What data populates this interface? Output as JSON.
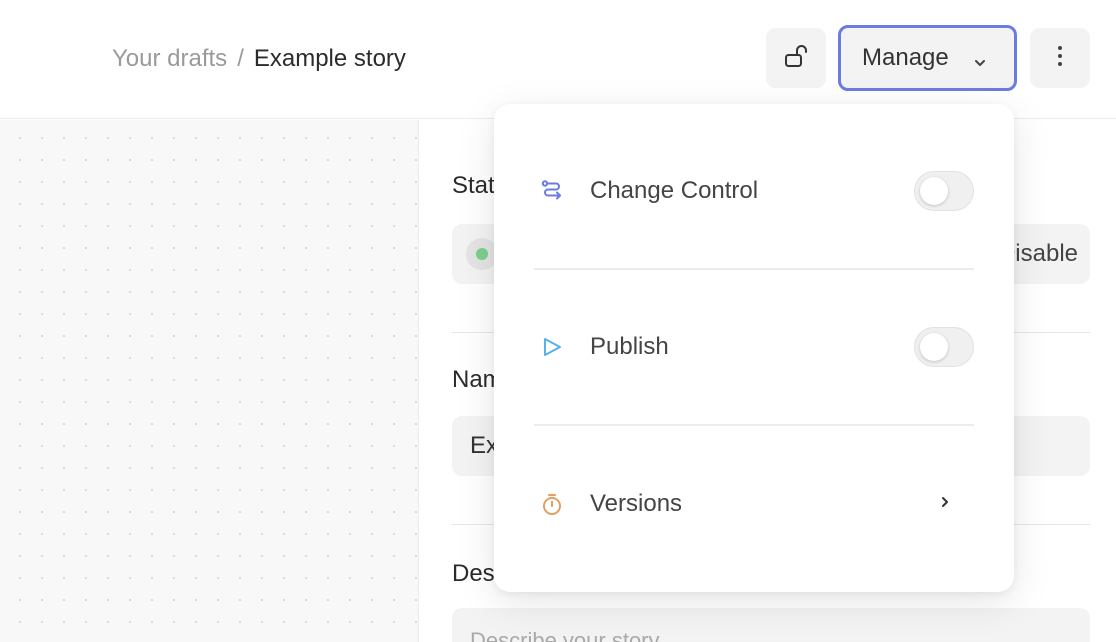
{
  "breadcrumb": {
    "parent": "Your drafts",
    "separator": "/",
    "current": "Example story"
  },
  "toolbar": {
    "lock_icon": "unlock-icon",
    "manage_label": "Manage",
    "manage_chevron_icon": "chevron-down-icon",
    "more_icon": "vertical-dots-icon",
    "accent_color": "#6b7ce0"
  },
  "panel": {
    "status_label": "Status",
    "status_dot_color": "#7cd08a",
    "status_action": "Disable",
    "name_label": "Name",
    "name_value": "Example story",
    "description_label": "Description",
    "description_placeholder": "Describe your story"
  },
  "manage_menu": {
    "items": [
      {
        "label": "Change Control",
        "icon": "branch-icon",
        "icon_color": "#6b7ce0",
        "control": "toggle",
        "on": false
      },
      {
        "label": "Publish",
        "icon": "play-icon",
        "icon_color": "#5ab0e8",
        "control": "toggle",
        "on": false
      },
      {
        "label": "Versions",
        "icon": "stopwatch-icon",
        "icon_color": "#e0a060",
        "control": "chevron"
      }
    ]
  }
}
